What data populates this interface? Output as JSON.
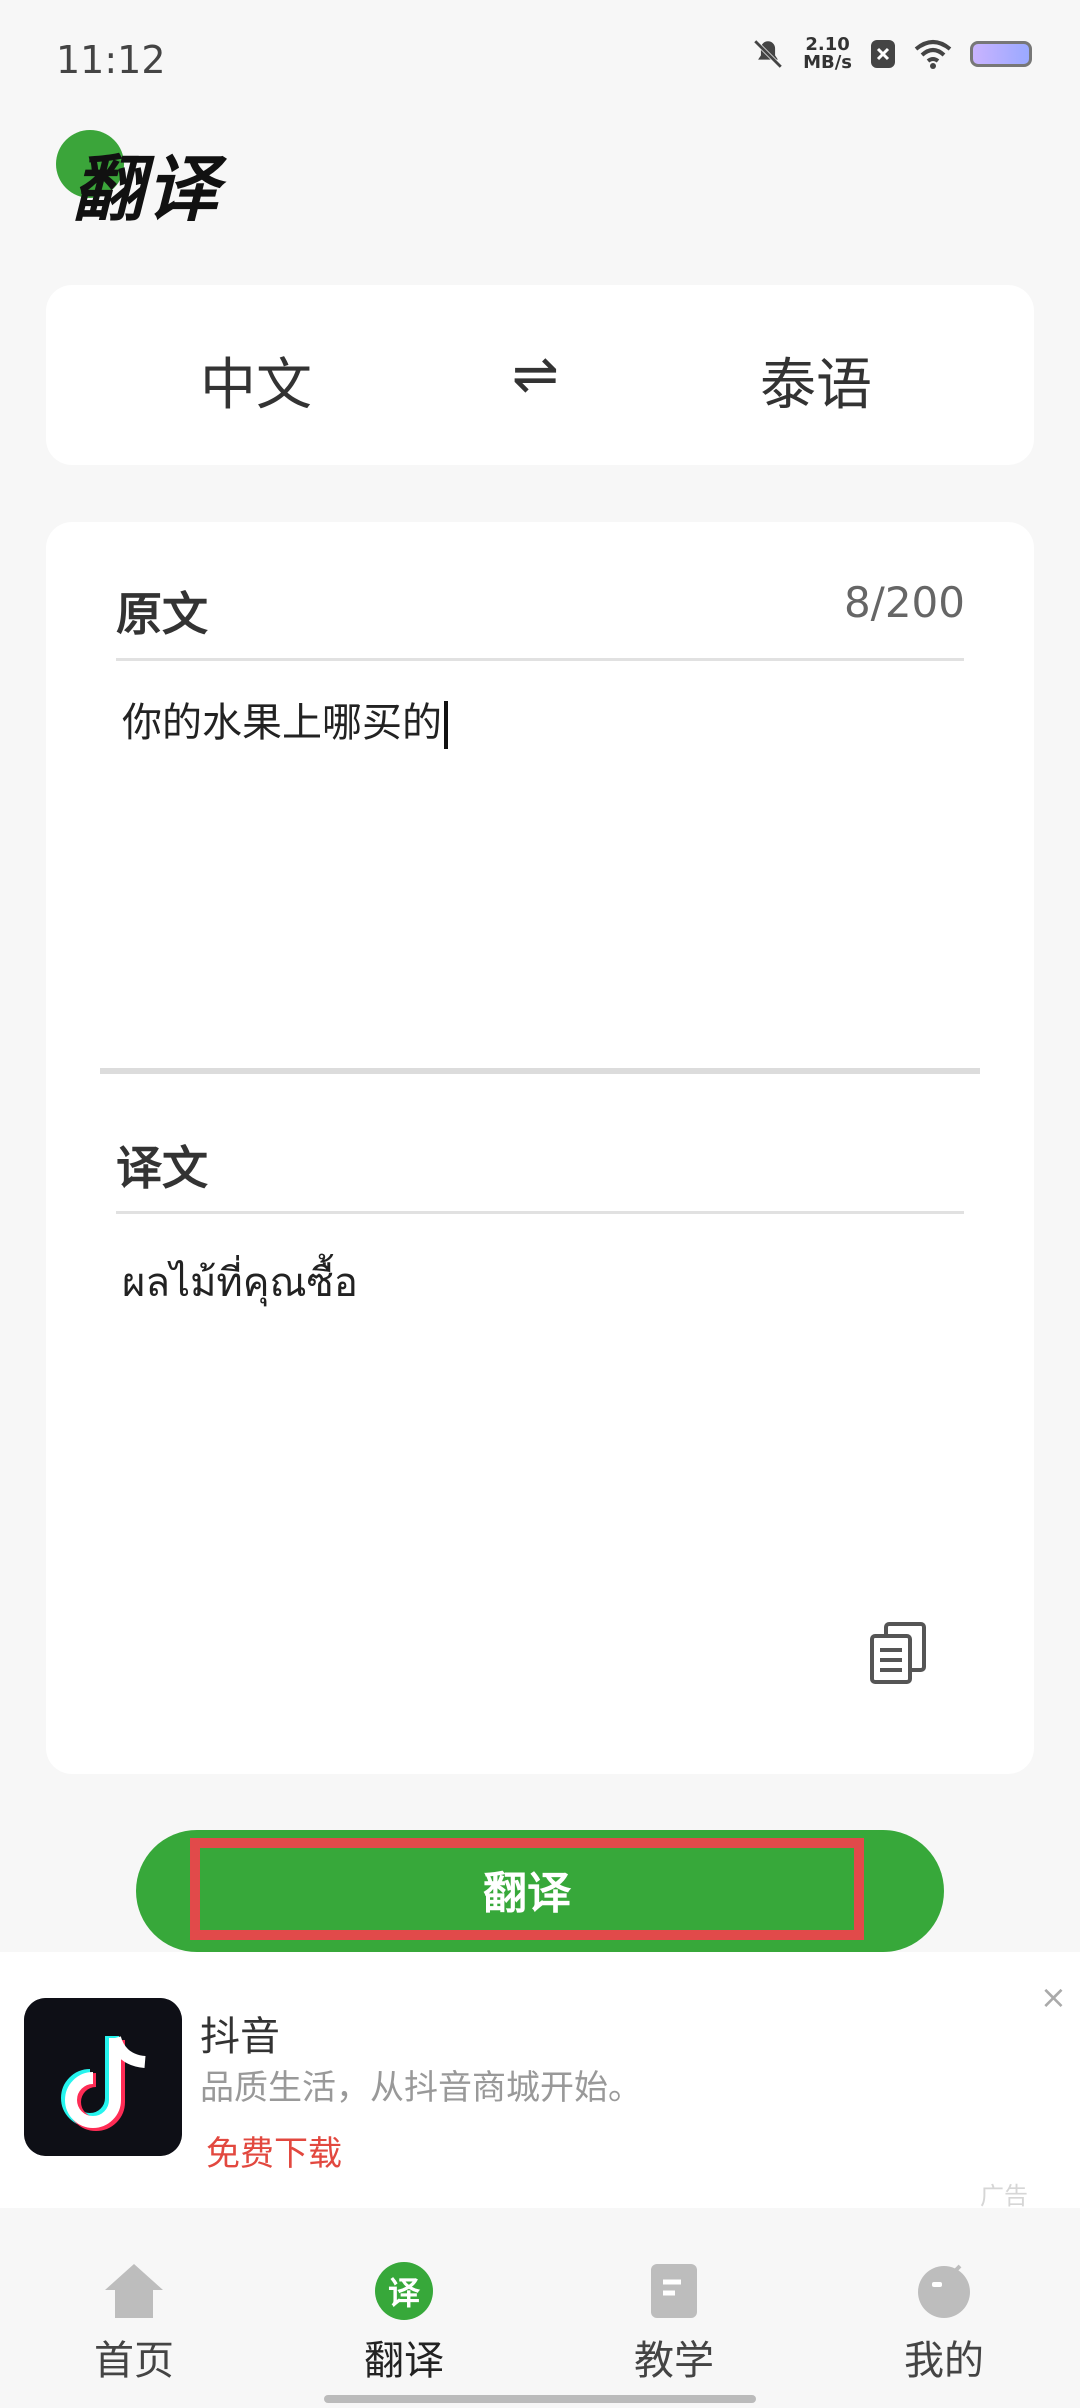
{
  "status_bar": {
    "time": "11:12",
    "speed_value": "2.10",
    "speed_unit": "MB/s",
    "icons": [
      "bell-off-icon",
      "close-badge-icon",
      "wifi-icon",
      "battery-icon"
    ]
  },
  "header": {
    "title": "翻译"
  },
  "languages": {
    "source": "中文",
    "swap_symbol": "⇌",
    "target": "泰语"
  },
  "source": {
    "label": "原文",
    "count": "8/200",
    "text": "你的水果上哪买的"
  },
  "result": {
    "label": "译文",
    "text": "ผลไม้ที่คุณซื้อ"
  },
  "translate_button": {
    "label": "翻译"
  },
  "ad": {
    "title": "抖音",
    "description": "品质生活，从抖音商城开始。",
    "cta": "免费下载",
    "tag": "广告",
    "close": "×"
  },
  "nav": {
    "items": [
      {
        "label": "首页",
        "icon": "home-icon"
      },
      {
        "label": "翻译",
        "icon": "translate-icon",
        "badge": "译"
      },
      {
        "label": "教学",
        "icon": "book-icon"
      },
      {
        "label": "我的",
        "icon": "profile-icon"
      }
    ]
  },
  "colors": {
    "accent": "#37a83a",
    "highlight_border": "#e14a4a",
    "ad_cta": "#e2483f"
  }
}
